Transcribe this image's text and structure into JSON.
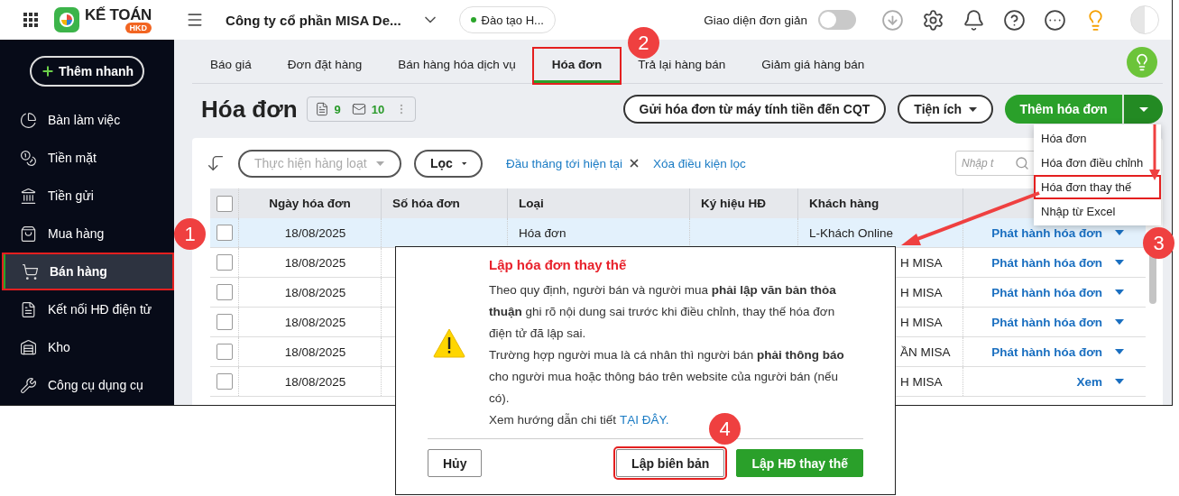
{
  "topbar": {
    "logo_text": "KẾ TOÁN",
    "logo_badge": "HKD",
    "company": "Công ty cổ phần MISA De...",
    "branch": "Đào tạo H...",
    "simple_mode": {
      "label": "Giao diện đơn giản",
      "on": false
    }
  },
  "sidebar": {
    "quick_add": "Thêm nhanh",
    "items": [
      {
        "label": "Bàn làm việc",
        "selected": false,
        "annotated": false
      },
      {
        "label": "Tiền mặt",
        "selected": false,
        "annotated": false
      },
      {
        "label": "Tiền gửi",
        "selected": false,
        "annotated": false
      },
      {
        "label": "Mua hàng",
        "selected": false,
        "annotated": false
      },
      {
        "label": "Bán hàng",
        "selected": true,
        "annotated": true,
        "callout": "1"
      },
      {
        "label": "Kết nối HĐ điện tử",
        "selected": false,
        "annotated": false
      },
      {
        "label": "Kho",
        "selected": false,
        "annotated": false
      },
      {
        "label": "Công cụ dụng cụ",
        "selected": false,
        "annotated": false
      }
    ]
  },
  "tabs": [
    {
      "label": "Báo giá",
      "selected": false,
      "annotated": false
    },
    {
      "label": "Đơn đặt hàng",
      "selected": false,
      "annotated": false
    },
    {
      "label": "Bán hàng hóa dịch vụ",
      "selected": false,
      "annotated": false
    },
    {
      "label": "Hóa đơn",
      "selected": true,
      "annotated": true,
      "callout": "2"
    },
    {
      "label": "Trả lại hàng bán",
      "selected": false,
      "annotated": false
    },
    {
      "label": "Giảm giá hàng bán",
      "selected": false,
      "annotated": false
    }
  ],
  "page": {
    "title": "Hóa đơn",
    "doc_count": "9",
    "mail_count": "10",
    "send_button": "Gửi hóa đơn từ máy tính tiền đến CQT",
    "utilities_button": "Tiện ích",
    "add_button": "Thêm hóa đơn",
    "add_menu": {
      "expanded": true,
      "items": [
        {
          "label": "Hóa đơn",
          "annotated": false
        },
        {
          "label": "Hóa đơn điều chỉnh",
          "annotated": false
        },
        {
          "label": "Hóa đơn thay thế",
          "annotated": true,
          "callout": "3"
        },
        {
          "label": "Nhập từ Excel",
          "annotated": false
        }
      ]
    }
  },
  "toolbar": {
    "bulk": {
      "label": "Thực hiện hàng loạt",
      "disabled": true
    },
    "filter": "Lọc",
    "chip": "Đầu tháng tới hiện tại",
    "clear": "Xóa điều kiện lọc",
    "search": {
      "placeholder": "Nhập t"
    }
  },
  "table": {
    "all_checked": false,
    "columns": [
      "Ngày hóa đơn",
      "Số hóa đơn",
      "Loại",
      "Ký hiệu HĐ",
      "Khách hàng"
    ],
    "rows": [
      {
        "selected": true,
        "checked": false,
        "date": "18/08/2025",
        "type": "Hóa đơn",
        "customer": "L-Khách Online",
        "customer_clipped": false,
        "action": "Phát hành hóa đơn"
      },
      {
        "selected": false,
        "checked": false,
        "date": "18/08/2025",
        "customer": "H MISA",
        "customer_clipped": true,
        "action": "Phát hành hóa đơn"
      },
      {
        "selected": false,
        "checked": false,
        "date": "18/08/2025",
        "customer": "H MISA",
        "customer_clipped": true,
        "action": "Phát hành hóa đơn"
      },
      {
        "selected": false,
        "checked": false,
        "date": "18/08/2025",
        "customer": "H MISA",
        "customer_clipped": true,
        "action": "Phát hành hóa đơn"
      },
      {
        "selected": false,
        "checked": false,
        "date": "18/08/2025",
        "customer": "ẦN MISA",
        "customer_clipped": true,
        "action": "Phát hành hóa đơn"
      },
      {
        "selected": false,
        "checked": false,
        "date": "18/08/2025",
        "customer": "H MISA",
        "customer_clipped": true,
        "action": "Xem"
      }
    ]
  },
  "dialog": {
    "title": "Lập hóa đơn thay thế",
    "paragraphs": [
      "Theo quy định, người bán và người mua **phải lập văn bản thỏa thuận** ghi rõ nội dung sai trước khi điều chỉnh, thay thế hóa đơn điện tử đã lập sai.",
      "Trường hợp người mua là cá nhân thì người bán **phải thông báo** cho người mua hoặc thông báo trên website của người bán (nếu có)."
    ],
    "guide_text": "Xem hướng dẫn chi tiết",
    "guide_link": "TẠI ĐÂY.",
    "buttons": [
      {
        "label": "Hủy",
        "kind": "cancel",
        "annotated": false
      },
      {
        "label": "Lập biên bản",
        "kind": "secondary",
        "annotated": true,
        "callout": "4"
      },
      {
        "label": "Lập HĐ thay thế",
        "kind": "primary",
        "annotated": false
      }
    ]
  }
}
